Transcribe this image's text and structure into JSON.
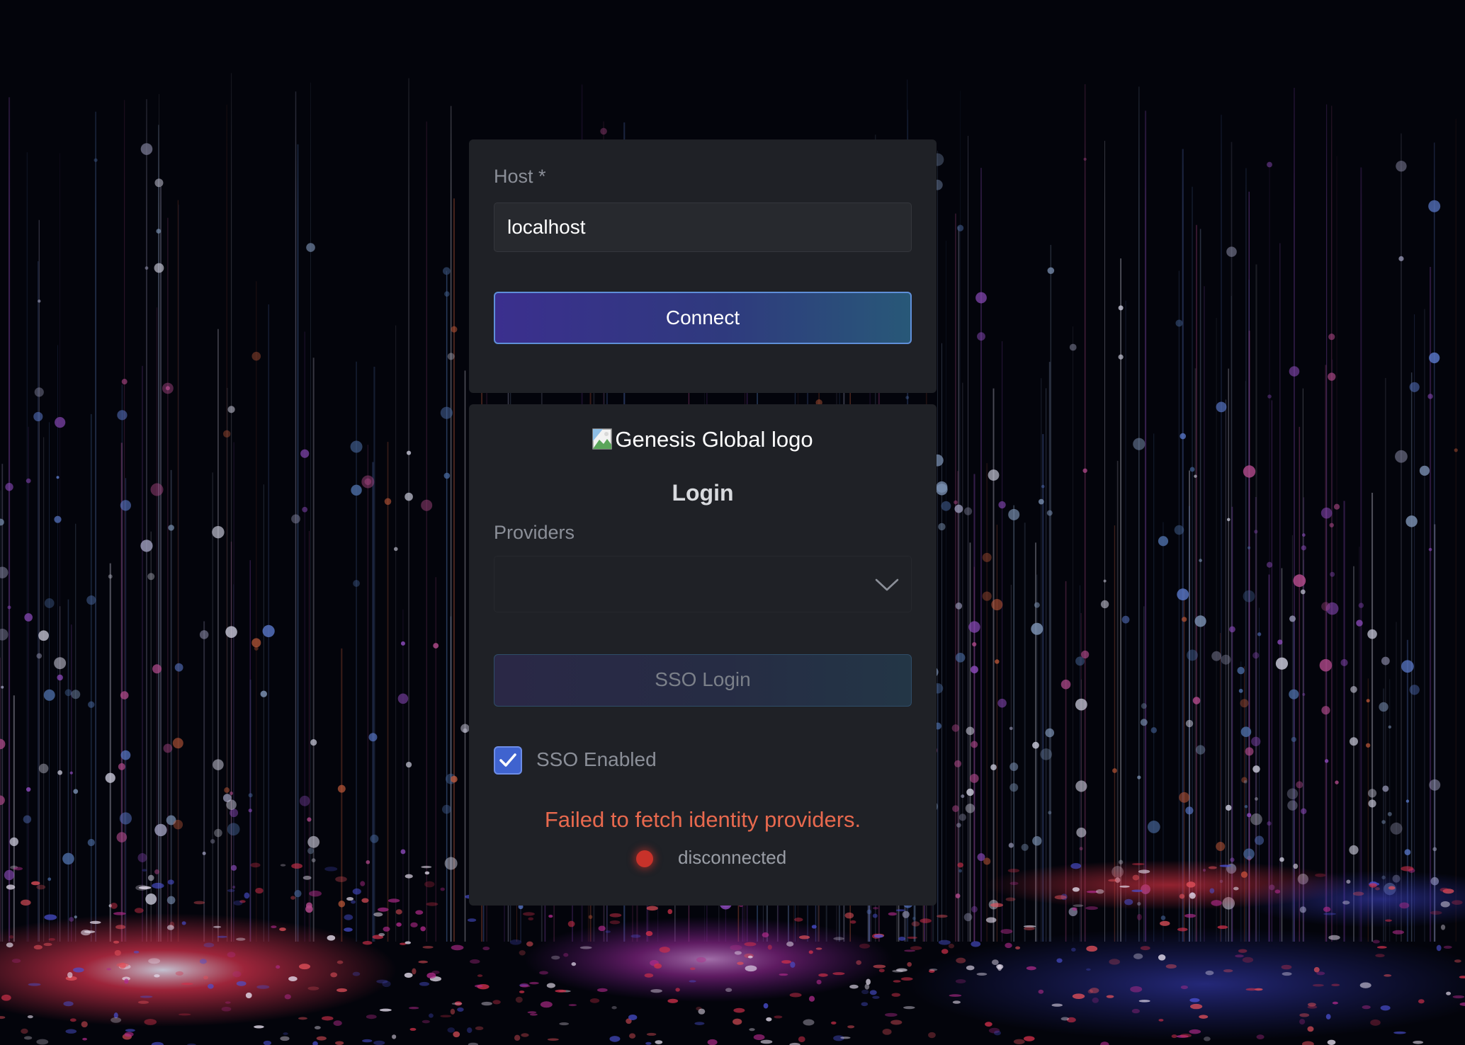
{
  "host_panel": {
    "host_label": "Host *",
    "host_value": "localhost",
    "connect_label": "Connect"
  },
  "login_panel": {
    "logo_alt": "Genesis Global logo",
    "title": "Login",
    "providers_label": "Providers",
    "providers_selected": "",
    "sso_login_label": "SSO Login",
    "sso_enabled_label": "SSO Enabled",
    "sso_enabled_checked": true,
    "error_message": "Failed to fetch identity providers.",
    "connection_status": "disconnected"
  },
  "colors": {
    "accent": "#3f63cf",
    "error": "#e8694e",
    "status_disconnected": "#c8322a",
    "panel_bg": "#1f2126"
  },
  "icons": {
    "logo": "broken-image-icon",
    "select": "chevron-down-icon",
    "checkbox": "checkmark-icon",
    "status": "status-dot-icon"
  }
}
